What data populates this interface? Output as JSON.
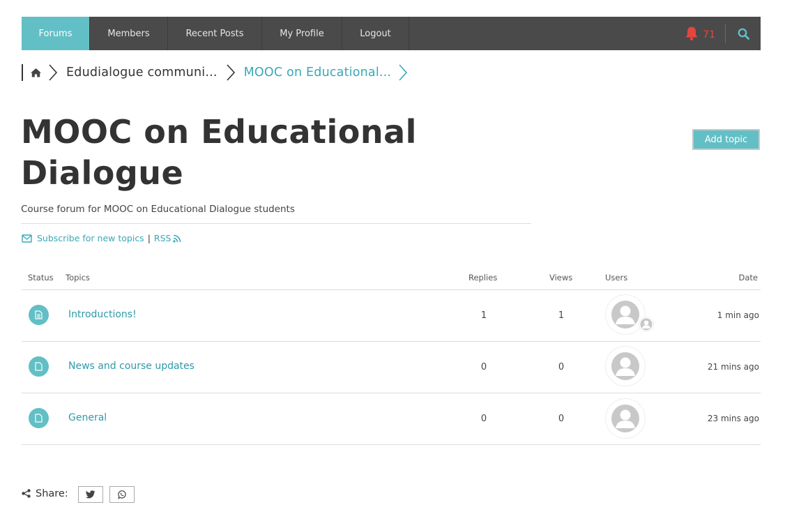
{
  "nav": {
    "items": [
      {
        "label": "Forums",
        "active": true
      },
      {
        "label": "Members"
      },
      {
        "label": "Recent Posts"
      },
      {
        "label": "My Profile"
      },
      {
        "label": "Logout"
      }
    ],
    "notification_count": "71"
  },
  "breadcrumb": {
    "items": [
      "Edudialogue communi...",
      "MOOC on Educational..."
    ]
  },
  "page": {
    "title": "MOOC on Educational Dialogue",
    "add_topic_label": "Add topic",
    "description": "Course forum for MOOC on Educational Dialogue students",
    "subscribe_label": "Subscribe for new topics",
    "separator": "|",
    "rss_label": "RSS"
  },
  "table": {
    "headers": {
      "status": "Status",
      "topics": "Topics",
      "replies": "Replies",
      "views": "Views",
      "users": "Users",
      "date": "Date"
    },
    "rows": [
      {
        "topic": "Introductions!",
        "replies": "1",
        "views": "1",
        "date": "1 min ago"
      },
      {
        "topic": "News and course updates",
        "replies": "0",
        "views": "0",
        "date": "21 mins ago"
      },
      {
        "topic": "General",
        "replies": "0",
        "views": "0",
        "date": "23 mins ago"
      }
    ]
  },
  "share": {
    "label": "Share:"
  },
  "colors": {
    "accent": "#62bfc5",
    "nav_bg": "#4a4a4a",
    "notification": "#e2473e",
    "link": "#3aa8b6"
  }
}
